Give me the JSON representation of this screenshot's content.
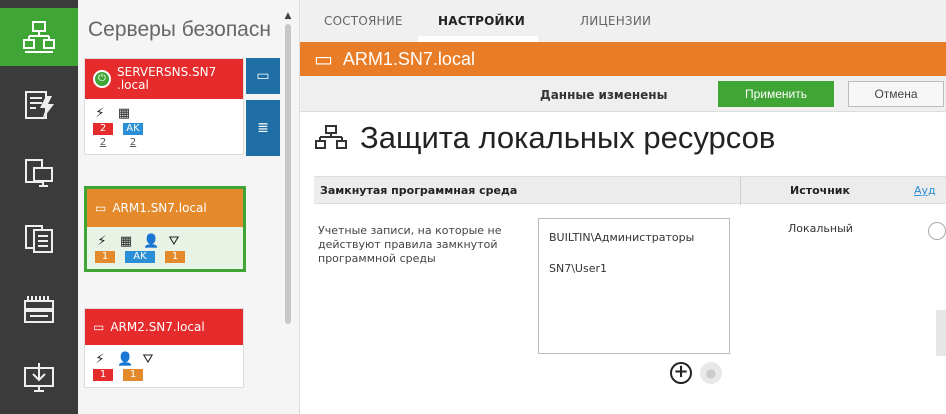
{
  "rail": {
    "icons": [
      "network-icon",
      "security-icon",
      "computer-icon",
      "server-icon",
      "switch-icon",
      "download-icon"
    ]
  },
  "server_list": {
    "title": "Серверы безопасн",
    "cards": [
      {
        "host_line1": "SERVERSNS.SN7",
        "host_line2": ".local",
        "badges": [
          "2",
          "AK"
        ],
        "sub": [
          "2",
          "2"
        ]
      },
      {
        "host": "ARM1.SN7.local",
        "badges": [
          "1",
          "AK",
          "1"
        ]
      },
      {
        "host": "ARM2.SN7.local",
        "badges": [
          "1",
          "1"
        ]
      }
    ]
  },
  "tabs": {
    "state": "СОСТОЯНИЕ",
    "settings": "НАСТРОЙКИ",
    "licenses": "ЛИЦЕНЗИИ"
  },
  "hostbar": {
    "title": "ARM1.SN7.local"
  },
  "actionbar": {
    "status": "Данные изменены",
    "apply": "Применить",
    "cancel": "Отмена"
  },
  "section": {
    "title": "Защита локальных ресурсов"
  },
  "table": {
    "col1": "Замкнутая программная среда",
    "col2": "Источник",
    "col3": "Ауд",
    "row_label": "Учетные записи, на которые не действуют правила замкнутой программной среды",
    "accounts": [
      "BUILTIN\\Администраторы",
      "SN7\\User1"
    ],
    "source": "Локальный"
  },
  "colors": {
    "green": "#3fa535",
    "orange": "#e97d27",
    "red": "#e52b2b",
    "blue": "#2a8fd6",
    "rail": "#3b3b3b"
  }
}
